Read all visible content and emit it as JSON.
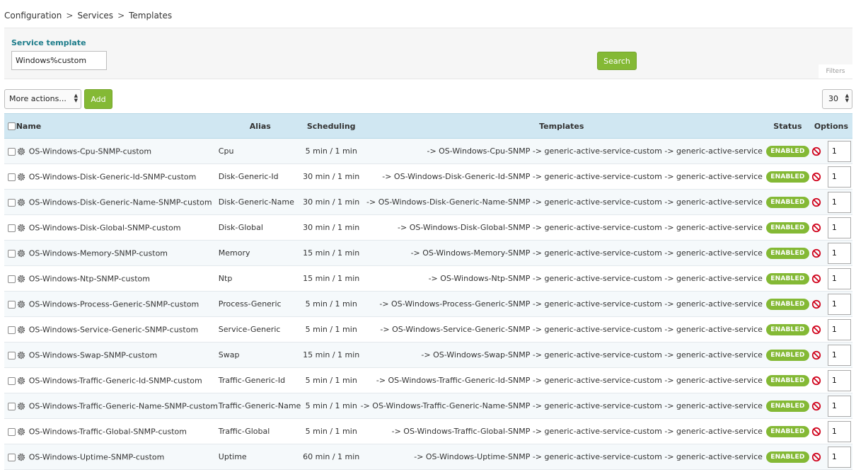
{
  "breadcrumb": [
    "Configuration",
    "Services",
    "Templates"
  ],
  "filters": {
    "label": "Service template",
    "search_value": "Windows%custom",
    "search_button": "Search",
    "filters_tag": "Filters"
  },
  "toolbar": {
    "actions_select": "More actions...",
    "add_label": "Add",
    "page_size": "30"
  },
  "columns": {
    "name": "Name",
    "alias": "Alias",
    "scheduling": "Scheduling",
    "templates": "Templates",
    "status": "Status",
    "options": "Options"
  },
  "colors": {
    "accent_green": "#84b935",
    "header_blue": "#d0e7f2",
    "label_teal": "#1d7c8a",
    "disable_red": "#d0021b"
  },
  "rows": [
    {
      "name": "OS-Windows-Cpu-SNMP-custom",
      "alias": "Cpu",
      "scheduling": "5 min / 1 min",
      "templates": "-> OS-Windows-Cpu-SNMP -> generic-active-service-custom -> generic-active-service",
      "status": "ENABLED",
      "duplicate": "1"
    },
    {
      "name": "OS-Windows-Disk-Generic-Id-SNMP-custom",
      "alias": "Disk-Generic-Id",
      "scheduling": "30 min / 1 min",
      "templates": "-> OS-Windows-Disk-Generic-Id-SNMP -> generic-active-service-custom -> generic-active-service",
      "status": "ENABLED",
      "duplicate": "1"
    },
    {
      "name": "OS-Windows-Disk-Generic-Name-SNMP-custom",
      "alias": "Disk-Generic-Name",
      "scheduling": "30 min / 1 min",
      "templates": "-> OS-Windows-Disk-Generic-Name-SNMP -> generic-active-service-custom -> generic-active-service",
      "status": "ENABLED",
      "duplicate": "1"
    },
    {
      "name": "OS-Windows-Disk-Global-SNMP-custom",
      "alias": "Disk-Global",
      "scheduling": "30 min / 1 min",
      "templates": "-> OS-Windows-Disk-Global-SNMP -> generic-active-service-custom -> generic-active-service",
      "status": "ENABLED",
      "duplicate": "1"
    },
    {
      "name": "OS-Windows-Memory-SNMP-custom",
      "alias": "Memory",
      "scheduling": "15 min / 1 min",
      "templates": "-> OS-Windows-Memory-SNMP -> generic-active-service-custom -> generic-active-service",
      "status": "ENABLED",
      "duplicate": "1"
    },
    {
      "name": "OS-Windows-Ntp-SNMP-custom",
      "alias": "Ntp",
      "scheduling": "15 min / 1 min",
      "templates": "-> OS-Windows-Ntp-SNMP -> generic-active-service-custom -> generic-active-service",
      "status": "ENABLED",
      "duplicate": "1"
    },
    {
      "name": "OS-Windows-Process-Generic-SNMP-custom",
      "alias": "Process-Generic",
      "scheduling": "5 min / 1 min",
      "templates": "-> OS-Windows-Process-Generic-SNMP -> generic-active-service-custom -> generic-active-service",
      "status": "ENABLED",
      "duplicate": "1"
    },
    {
      "name": "OS-Windows-Service-Generic-SNMP-custom",
      "alias": "Service-Generic",
      "scheduling": "5 min / 1 min",
      "templates": "-> OS-Windows-Service-Generic-SNMP -> generic-active-service-custom -> generic-active-service",
      "status": "ENABLED",
      "duplicate": "1"
    },
    {
      "name": "OS-Windows-Swap-SNMP-custom",
      "alias": "Swap",
      "scheduling": "15 min / 1 min",
      "templates": "-> OS-Windows-Swap-SNMP -> generic-active-service-custom -> generic-active-service",
      "status": "ENABLED",
      "duplicate": "1"
    },
    {
      "name": "OS-Windows-Traffic-Generic-Id-SNMP-custom",
      "alias": "Traffic-Generic-Id",
      "scheduling": "5 min / 1 min",
      "templates": "-> OS-Windows-Traffic-Generic-Id-SNMP -> generic-active-service-custom -> generic-active-service",
      "status": "ENABLED",
      "duplicate": "1"
    },
    {
      "name": "OS-Windows-Traffic-Generic-Name-SNMP-custom",
      "alias": "Traffic-Generic-Name",
      "scheduling": "5 min / 1 min",
      "templates": "-> OS-Windows-Traffic-Generic-Name-SNMP -> generic-active-service-custom -> generic-active-service",
      "status": "ENABLED",
      "duplicate": "1"
    },
    {
      "name": "OS-Windows-Traffic-Global-SNMP-custom",
      "alias": "Traffic-Global",
      "scheduling": "5 min / 1 min",
      "templates": "-> OS-Windows-Traffic-Global-SNMP -> generic-active-service-custom -> generic-active-service",
      "status": "ENABLED",
      "duplicate": "1"
    },
    {
      "name": "OS-Windows-Uptime-SNMP-custom",
      "alias": "Uptime",
      "scheduling": "60 min / 1 min",
      "templates": "-> OS-Windows-Uptime-SNMP -> generic-active-service-custom -> generic-active-service",
      "status": "ENABLED",
      "duplicate": "1"
    }
  ]
}
